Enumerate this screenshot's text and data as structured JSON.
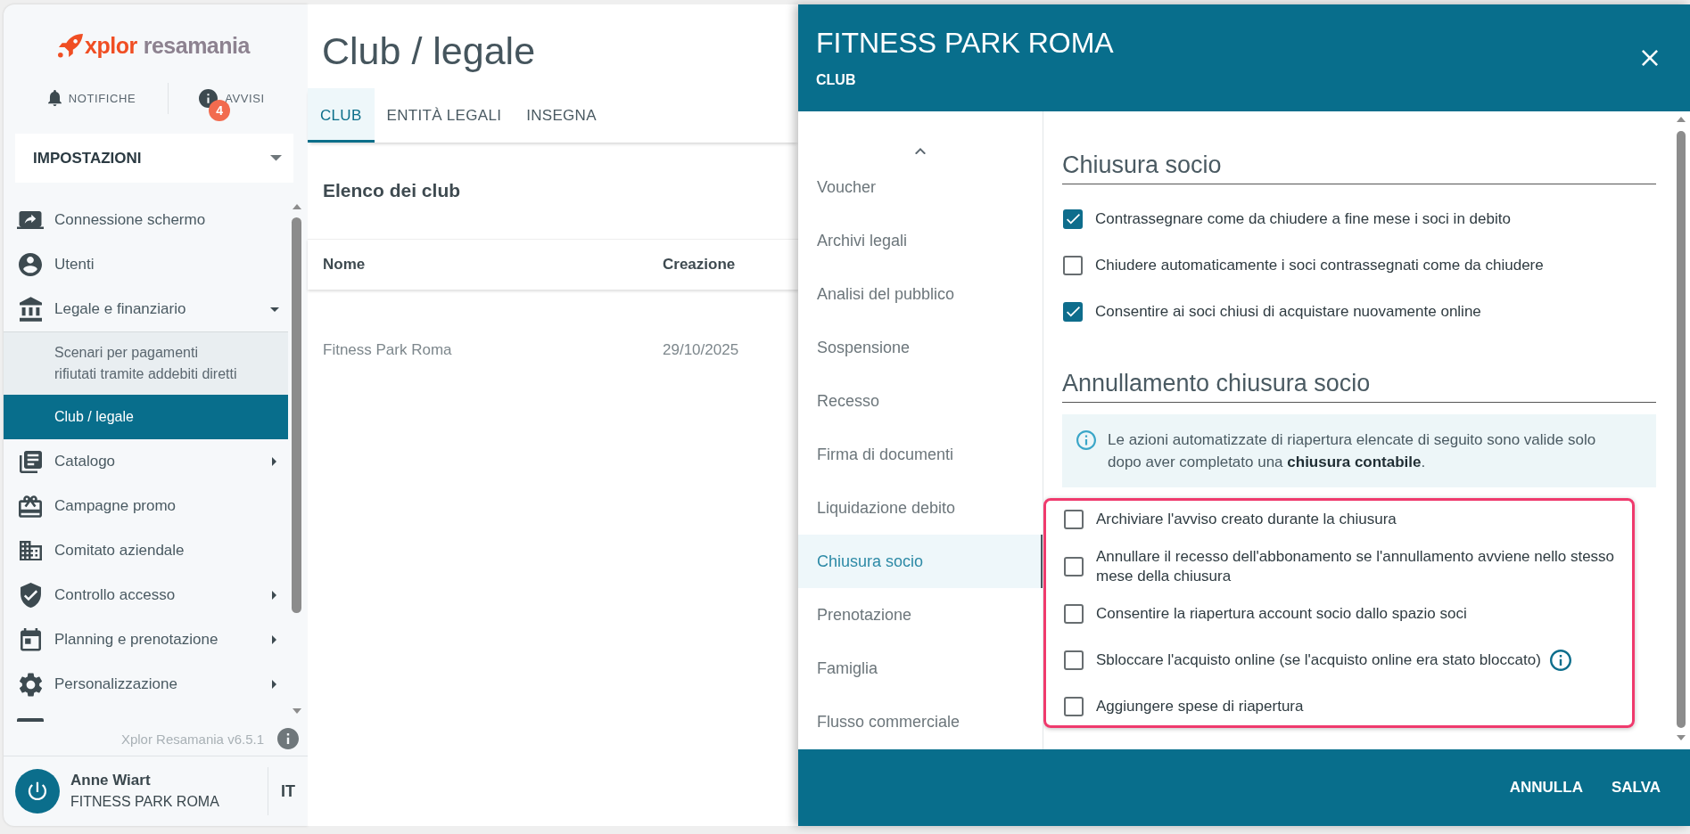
{
  "sidebar": {
    "logo": {
      "brand": "xplor",
      "product": "resamania"
    },
    "top_links": [
      {
        "label": "NOTIFICHE"
      },
      {
        "label": "AVVISI",
        "badge": "4"
      }
    ],
    "section_select": {
      "value": "IMPOSTAZIONI"
    },
    "menu": [
      {
        "label": "Connessione schermo"
      },
      {
        "label": "Utenti"
      },
      {
        "label": "Legale e finanziario",
        "expanded": true,
        "children": [
          {
            "label": "Scenari per pagamenti rifiutati tramite addebiti diretti",
            "selected": false
          },
          {
            "label": "Club / legale",
            "selected": true
          }
        ]
      },
      {
        "label": "Catalogo",
        "expanded": false
      },
      {
        "label": "Campagne promo"
      },
      {
        "label": "Comitato aziendale"
      },
      {
        "label": "Controllo accesso",
        "expanded": false
      },
      {
        "label": "Planning e prenotazione",
        "expanded": false
      },
      {
        "label": "Personalizzazione",
        "expanded": false
      }
    ],
    "version": "Xplor Resamania v6.5.1",
    "user": {
      "name": "Anne Wiart",
      "club": "FITNESS PARK ROMA",
      "language": "IT"
    }
  },
  "page": {
    "title": "Club / legale",
    "tabs": [
      {
        "label": "CLUB",
        "selected": true
      },
      {
        "label": "ENTITÀ LEGALI",
        "selected": false
      },
      {
        "label": "INSEGNA",
        "selected": false
      }
    ],
    "list": {
      "title": "Elenco dei club",
      "columns": [
        "Nome",
        "Creazione"
      ],
      "rows": [
        [
          "Fitness Park Roma",
          "29/10/2025"
        ]
      ]
    }
  },
  "drawer": {
    "title": "FITNESS PARK ROMA",
    "subtitle": "CLUB",
    "nav": [
      {
        "label": "Voucher",
        "selected": false
      },
      {
        "label": "Archivi legali",
        "selected": false
      },
      {
        "label": "Analisi del pubblico",
        "selected": false
      },
      {
        "label": "Sospensione",
        "selected": false
      },
      {
        "label": "Recesso",
        "selected": false
      },
      {
        "label": "Firma di documenti",
        "selected": false
      },
      {
        "label": "Liquidazione debito",
        "selected": false
      },
      {
        "label": "Chiusura socio",
        "selected": true
      },
      {
        "label": "Prenotazione",
        "selected": false
      },
      {
        "label": "Famiglia",
        "selected": false
      },
      {
        "label": "Flusso commerciale",
        "selected": false
      }
    ],
    "sections": [
      {
        "title": "Chiusura socio",
        "highlighted": false,
        "options": [
          {
            "label": "Contrassegnare come da chiudere a fine mese i soci in debito",
            "checked": true,
            "info": false
          },
          {
            "label": "Chiudere automaticamente i soci contrassegnati come da chiudere",
            "checked": false,
            "info": false
          },
          {
            "label": "Consentire ai soci chiusi di acquistare nuovamente online",
            "checked": true,
            "info": false
          }
        ]
      },
      {
        "title": "Annullamento chiusura socio",
        "note": "Le azioni automatizzate di riapertura elencate di seguito sono valide solo dopo aver completato una **chiusura contabile**.",
        "highlighted": true,
        "options": [
          {
            "label": "Archiviare l'avviso creato durante la chiusura",
            "checked": false,
            "info": false
          },
          {
            "label": "Annullare il recesso dell'abbonamento se l'annullamento avviene nello stesso mese della chiusura",
            "checked": false,
            "info": false
          },
          {
            "label": "Consentire la riapertura account socio dallo spazio soci",
            "checked": false,
            "info": false
          },
          {
            "label": "Sbloccare l'acquisto online (se l'acquisto online era stato bloccato)",
            "checked": false,
            "info": true
          },
          {
            "label": "Aggiungere spese di riapertura",
            "checked": false,
            "info": false
          }
        ]
      }
    ],
    "actions": [
      "ANNULLA",
      "SALVA"
    ]
  }
}
